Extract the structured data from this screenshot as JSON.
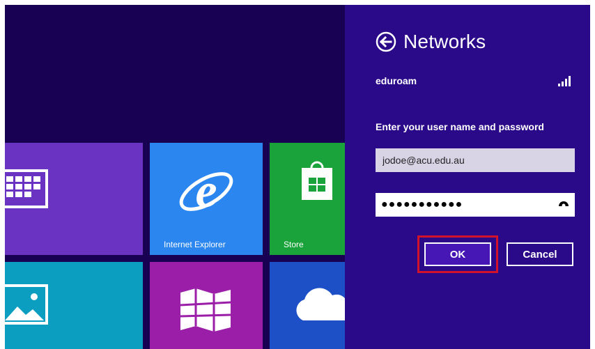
{
  "panel": {
    "title": "Networks",
    "network_name": "eduroam",
    "prompt": "Enter your user name and password",
    "username_value": "jodoe@acu.edu.au",
    "password_value": "●●●●●●●●●●●",
    "ok_label": "OK",
    "cancel_label": "Cancel"
  },
  "tiles": {
    "ie_label": "Internet Explorer",
    "store_label": "Store"
  },
  "colors": {
    "panel_bg": "#2b0a8a",
    "start_bg": "#180052",
    "highlight": "#d0122b"
  },
  "icons": [
    "back-arrow-icon",
    "wifi-signal-icon",
    "reveal-password-icon",
    "calendar-icon",
    "internet-explorer-icon",
    "store-icon",
    "photos-icon",
    "maps-icon",
    "skydrive-icon"
  ]
}
